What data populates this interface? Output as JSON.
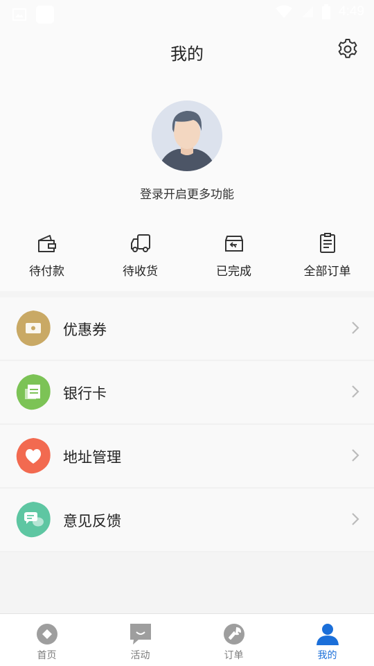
{
  "status_bar": {
    "time": "4:49"
  },
  "header": {
    "title": "我的"
  },
  "profile": {
    "login_prompt": "登录开启更多功能"
  },
  "orders": [
    {
      "label": "待付款",
      "icon": "wallet-icon"
    },
    {
      "label": "待收货",
      "icon": "truck-icon"
    },
    {
      "label": "已完成",
      "icon": "return-box-icon"
    },
    {
      "label": "全部订单",
      "icon": "clipboard-icon"
    }
  ],
  "menu": [
    {
      "label": "优惠券",
      "icon": "coupon-icon",
      "color": "#c9a965"
    },
    {
      "label": "银行卡",
      "icon": "bank-card-icon",
      "color": "#7cc356"
    },
    {
      "label": "地址管理",
      "icon": "heart-icon",
      "color": "#f26a50"
    },
    {
      "label": "意见反馈",
      "icon": "chat-bubbles-icon",
      "color": "#5ec6a2"
    }
  ],
  "tabbar": [
    {
      "label": "首页",
      "icon": "home-compass-icon",
      "active": false
    },
    {
      "label": "活动",
      "icon": "activity-chat-icon",
      "active": false
    },
    {
      "label": "订单",
      "icon": "wrench-icon",
      "active": false
    },
    {
      "label": "我的",
      "icon": "person-icon",
      "active": true
    }
  ],
  "colors": {
    "accent": "#1b6fd9",
    "tab_inactive": "#9e9e9e"
  }
}
